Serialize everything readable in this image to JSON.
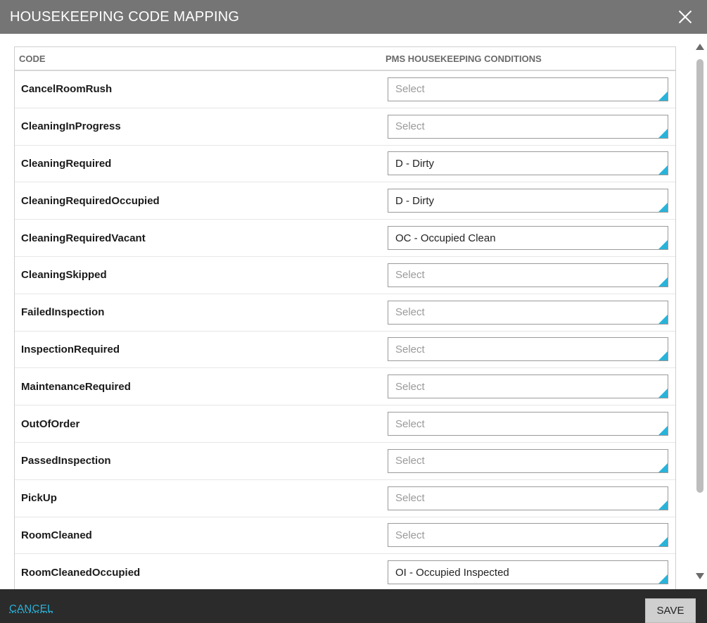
{
  "dialog": {
    "title": "HOUSEKEEPING CODE MAPPING",
    "close_icon": "close-icon"
  },
  "table": {
    "headers": {
      "code": "CODE",
      "conditions": "PMS HOUSEKEEPING CONDITIONS"
    },
    "placeholder": "Select",
    "rows": [
      {
        "code": "CancelRoomRush",
        "value": ""
      },
      {
        "code": "CleaningInProgress",
        "value": ""
      },
      {
        "code": "CleaningRequired",
        "value": "D - Dirty"
      },
      {
        "code": "CleaningRequiredOccupied",
        "value": "D - Dirty"
      },
      {
        "code": "CleaningRequiredVacant",
        "value": "OC - Occupied Clean"
      },
      {
        "code": "CleaningSkipped",
        "value": ""
      },
      {
        "code": "FailedInspection",
        "value": ""
      },
      {
        "code": "InspectionRequired",
        "value": ""
      },
      {
        "code": "MaintenanceRequired",
        "value": ""
      },
      {
        "code": "OutOfOrder",
        "value": ""
      },
      {
        "code": "PassedInspection",
        "value": ""
      },
      {
        "code": "PickUp",
        "value": ""
      },
      {
        "code": "RoomCleaned",
        "value": ""
      },
      {
        "code": "RoomCleanedOccupied",
        "value": "OI - Occupied Inspected"
      },
      {
        "code": "",
        "value": ""
      }
    ]
  },
  "footer": {
    "cancel_label": "CANCEL",
    "save_label": "SAVE"
  },
  "colors": {
    "titlebar": "#757575",
    "footer": "#2b2b2b",
    "accent": "#2ab3d9"
  }
}
